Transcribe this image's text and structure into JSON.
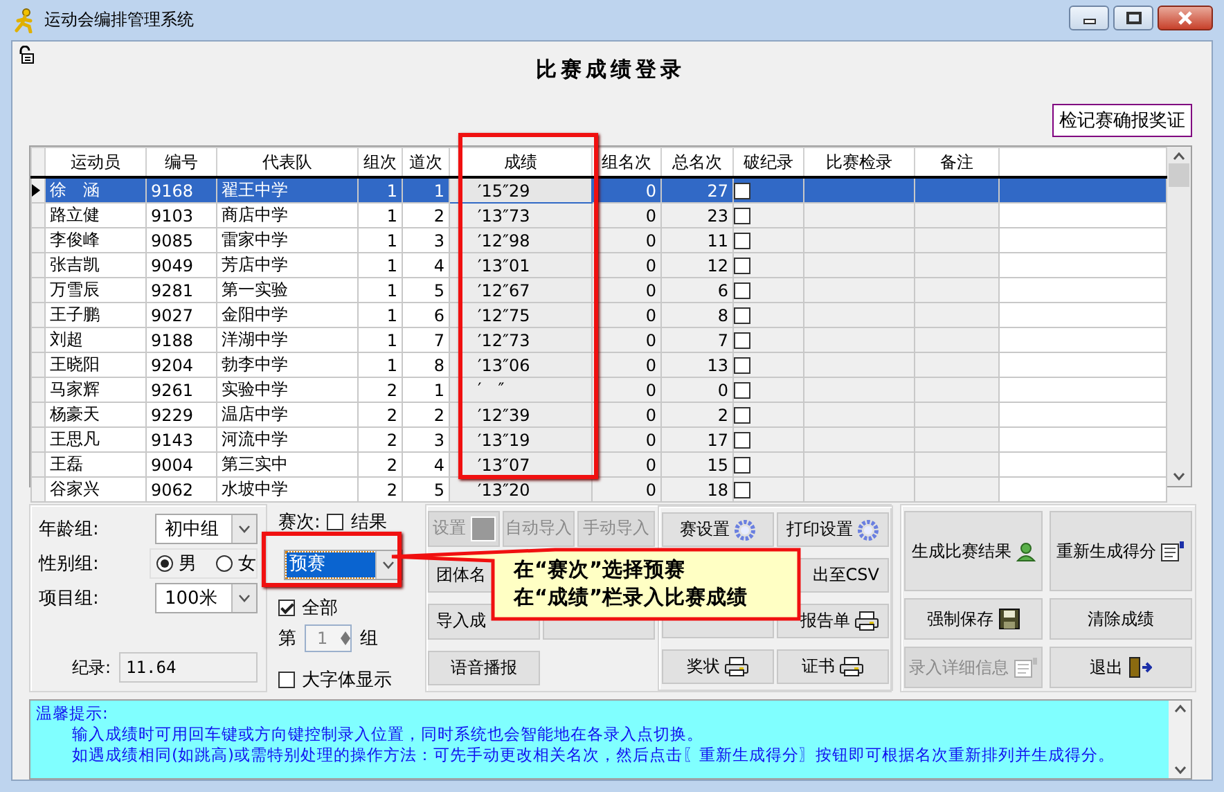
{
  "window": {
    "title": "运动会编排管理系统"
  },
  "header": {
    "title": "比赛成绩登录",
    "award_button": "检记赛确报奖证"
  },
  "table": {
    "columns": [
      "运动员",
      "编号",
      "代表队",
      "组次",
      "道次",
      "成绩",
      "组名次",
      "总名次",
      "破纪录",
      "比赛检录",
      "备注"
    ],
    "rows": [
      {
        "name": "徐　涵",
        "id": "9168",
        "team": "翟王中学",
        "group": "1",
        "lane": "1",
        "score": "′15″29",
        "group_rank": "0",
        "total_rank": "27",
        "record_broken": false,
        "selected": true
      },
      {
        "name": "路立健",
        "id": "9103",
        "team": "商店中学",
        "group": "1",
        "lane": "2",
        "score": "′13″73",
        "group_rank": "0",
        "total_rank": "23",
        "record_broken": false,
        "selected": false
      },
      {
        "name": "李俊峰",
        "id": "9085",
        "team": "雷家中学",
        "group": "1",
        "lane": "3",
        "score": "′12″98",
        "group_rank": "0",
        "total_rank": "11",
        "record_broken": false,
        "selected": false
      },
      {
        "name": "张吉凯",
        "id": "9049",
        "team": "芳店中学",
        "group": "1",
        "lane": "4",
        "score": "′13″01",
        "group_rank": "0",
        "total_rank": "12",
        "record_broken": false,
        "selected": false
      },
      {
        "name": "万雪辰",
        "id": "9281",
        "team": "第一实验",
        "group": "1",
        "lane": "5",
        "score": "′12″67",
        "group_rank": "0",
        "total_rank": "6",
        "record_broken": false,
        "selected": false
      },
      {
        "name": "王子鹏",
        "id": "9027",
        "team": "金阳中学",
        "group": "1",
        "lane": "6",
        "score": "′12″75",
        "group_rank": "0",
        "total_rank": "8",
        "record_broken": false,
        "selected": false
      },
      {
        "name": "刘超",
        "id": "9188",
        "team": "洋湖中学",
        "group": "1",
        "lane": "7",
        "score": "′12″73",
        "group_rank": "0",
        "total_rank": "7",
        "record_broken": false,
        "selected": false
      },
      {
        "name": "王晓阳",
        "id": "9204",
        "team": "勃李中学",
        "group": "1",
        "lane": "8",
        "score": "′13″06",
        "group_rank": "0",
        "total_rank": "13",
        "record_broken": false,
        "selected": false
      },
      {
        "name": "马家辉",
        "id": "9261",
        "team": "实验中学",
        "group": "2",
        "lane": "1",
        "score": "′　″",
        "group_rank": "0",
        "total_rank": "0",
        "record_broken": false,
        "selected": false
      },
      {
        "name": "杨豪天",
        "id": "9229",
        "team": "温店中学",
        "group": "2",
        "lane": "2",
        "score": "′12″39",
        "group_rank": "0",
        "total_rank": "2",
        "record_broken": false,
        "selected": false
      },
      {
        "name": "王思凡",
        "id": "9143",
        "team": "河流中学",
        "group": "2",
        "lane": "3",
        "score": "′13″19",
        "group_rank": "0",
        "total_rank": "17",
        "record_broken": false,
        "selected": false
      },
      {
        "name": "王磊",
        "id": "9004",
        "team": "第三实中",
        "group": "2",
        "lane": "4",
        "score": "′13″07",
        "group_rank": "0",
        "total_rank": "15",
        "record_broken": false,
        "selected": false
      },
      {
        "name": "谷家兴",
        "id": "9062",
        "team": "水坡中学",
        "group": "2",
        "lane": "5",
        "score": "′13″20",
        "group_rank": "0",
        "total_rank": "18",
        "record_broken": false,
        "selected": false
      }
    ]
  },
  "filters": {
    "age_group": {
      "label": "年龄组:",
      "value": "初中组"
    },
    "gender": {
      "label": "性别组:",
      "options": [
        {
          "label": "男",
          "selected": true
        },
        {
          "label": "女",
          "selected": false
        }
      ]
    },
    "event": {
      "label": "项目组:",
      "value": "100米"
    },
    "record": {
      "label": "纪录:",
      "value": "11.64"
    }
  },
  "round": {
    "label": "赛次:",
    "results_checkbox": {
      "label": "结果",
      "checked": false
    },
    "value": "预赛",
    "all_checkbox": {
      "label": "全部",
      "checked": true
    },
    "group_spinner": {
      "prefix": "第",
      "value": "1",
      "suffix": "组"
    },
    "large_font_checkbox": {
      "label": "大字体显示",
      "checked": false
    }
  },
  "middle_panel": {
    "left_group": [
      [
        {
          "kind": "button",
          "label": "设置",
          "disabled": true
        },
        {
          "kind": "button",
          "label": "自动导入",
          "disabled": true
        },
        {
          "kind": "button",
          "label": "手动导入",
          "disabled": true
        }
      ],
      [
        {
          "kind": "button",
          "label": "团体名",
          "disabled": false
        },
        {
          "kind": "empty"
        }
      ],
      [
        {
          "kind": "button",
          "label": "导入成",
          "disabled": false
        },
        {
          "kind": "blank"
        }
      ],
      [
        {
          "kind": "button",
          "label": "语音播报",
          "disabled": false
        },
        {
          "kind": "empty"
        }
      ]
    ],
    "right_group": [
      [
        {
          "kind": "button",
          "label": "赛设置",
          "disabled": false
        },
        {
          "kind": "button",
          "label": "打印设置",
          "disabled": false
        }
      ],
      [
        {
          "kind": "empty"
        },
        {
          "kind": "button",
          "label": "出至CSV",
          "disabled": false
        }
      ],
      [
        {
          "kind": "blank"
        },
        {
          "kind": "button",
          "label": "报告单",
          "disabled": false
        }
      ],
      [
        {
          "kind": "button",
          "label": "奖状",
          "disabled": false
        },
        {
          "kind": "button",
          "label": "证书",
          "disabled": false
        }
      ]
    ]
  },
  "action_panel": [
    {
      "label": "生成比赛结果",
      "disabled": false
    },
    {
      "label": "重新生成得分",
      "disabled": false
    },
    {
      "label": "强制保存",
      "disabled": false
    },
    {
      "label": "清除成绩",
      "disabled": false
    },
    {
      "label": "录入详细信息",
      "disabled": true
    },
    {
      "label": "退出",
      "disabled": false
    }
  ],
  "callout": {
    "lines": [
      "在“赛次”选择预赛",
      "在“成绩”栏录入比赛成绩"
    ]
  },
  "tips": {
    "title": "温馨提示:",
    "lines": [
      "输入成绩时可用回车键或方向键控制录入位置，同时系统也会智能地在各录入点切换。",
      "如遇成绩相同(如跳高)或需特别处理的操作方法：可先手动更改相关名次，然后点击〖重新生成得分〗按钮即可根据名次重新排列并生成得分。"
    ]
  }
}
